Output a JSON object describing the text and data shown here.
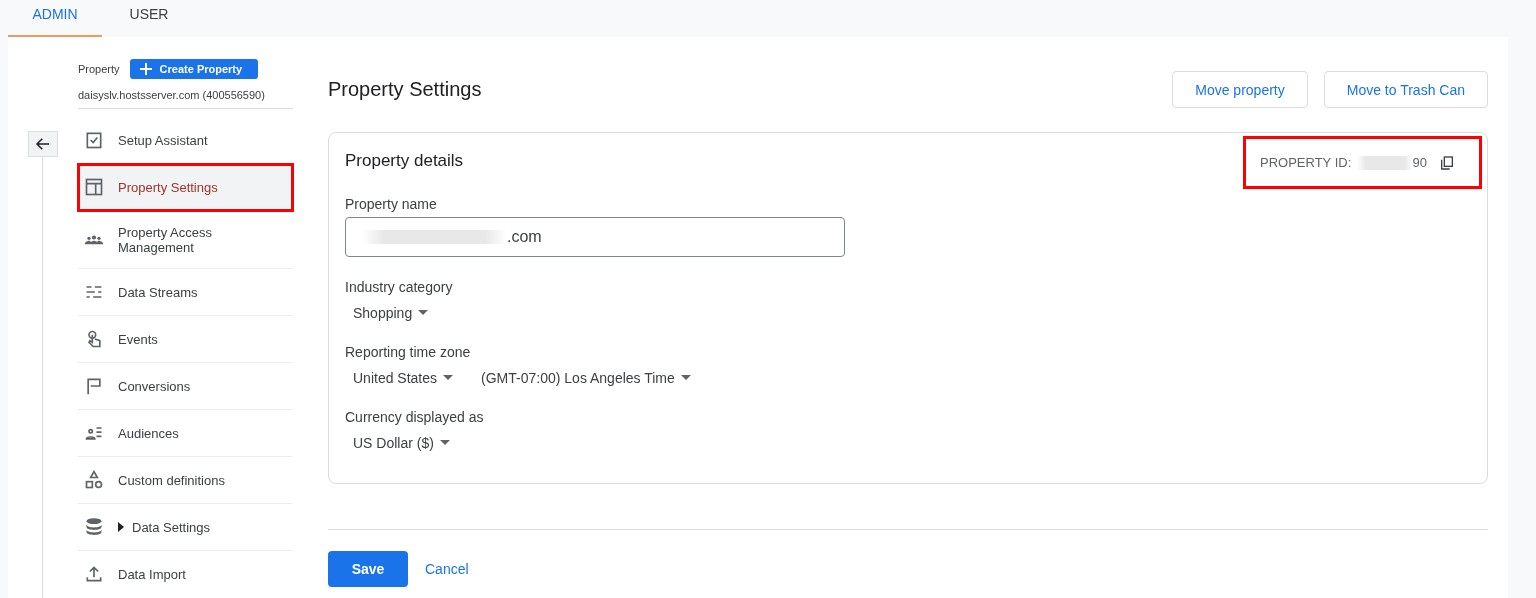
{
  "tabs": [
    {
      "label": "ADMIN",
      "selected": true
    },
    {
      "label": "USER",
      "selected": false
    }
  ],
  "sidebar": {
    "property_label": "Property",
    "create_button": "Create Property",
    "property_account": "daisyslv.hostsserver.com (400556590)",
    "items": [
      {
        "label": "Setup Assistant",
        "selected": false,
        "highlighted": false,
        "expandable": false
      },
      {
        "label": "Property Settings",
        "selected": true,
        "highlighted": true,
        "expandable": false
      },
      {
        "label": "Property Access Management",
        "selected": false,
        "highlighted": false,
        "expandable": false
      },
      {
        "label": "Data Streams",
        "selected": false,
        "highlighted": false,
        "expandable": false
      },
      {
        "label": "Events",
        "selected": false,
        "highlighted": false,
        "expandable": false
      },
      {
        "label": "Conversions",
        "selected": false,
        "highlighted": false,
        "expandable": false
      },
      {
        "label": "Audiences",
        "selected": false,
        "highlighted": false,
        "expandable": false
      },
      {
        "label": "Custom definitions",
        "selected": false,
        "highlighted": false,
        "expandable": false
      },
      {
        "label": "Data Settings",
        "selected": false,
        "highlighted": false,
        "expandable": true
      },
      {
        "label": "Data Import",
        "selected": false,
        "highlighted": false,
        "expandable": false
      }
    ]
  },
  "page": {
    "title": "Property Settings",
    "actions": [
      "Move property",
      "Move to Trash Can"
    ]
  },
  "details": {
    "title": "Property details",
    "property_id": {
      "label": "PROPERTY ID:",
      "value_end": "90",
      "highlighted": true
    },
    "property_name": {
      "label": "Property name",
      "value": ".com"
    },
    "fields": [
      {
        "label": "Industry category",
        "dropdowns": [
          "Shopping"
        ]
      },
      {
        "label": "Reporting time zone",
        "dropdowns": [
          "United States",
          "(GMT-07:00) Los Angeles Time"
        ]
      },
      {
        "label": "Currency displayed as",
        "dropdowns": [
          "US Dollar ($)"
        ]
      }
    ]
  },
  "footer": {
    "save": "Save",
    "cancel": "Cancel"
  }
}
